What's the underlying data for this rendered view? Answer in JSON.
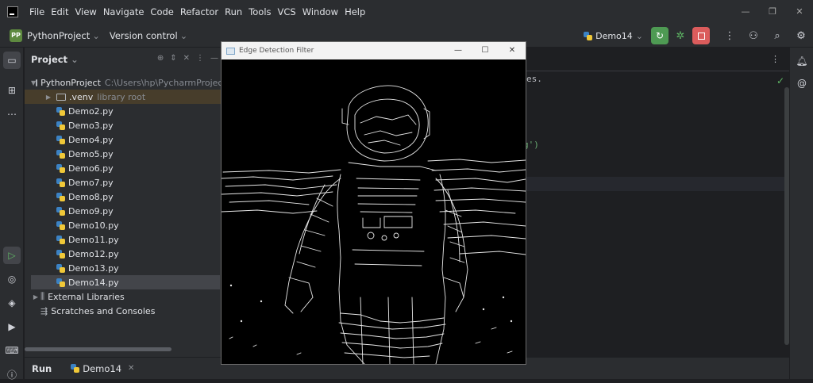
{
  "menu": [
    "File",
    "Edit",
    "View",
    "Navigate",
    "Code",
    "Refactor",
    "Run",
    "Tools",
    "VCS",
    "Window",
    "Help"
  ],
  "toolbar": {
    "project_badge": "PP",
    "project_name": "PythonProject",
    "version_control": "Version control",
    "run_config": "Demo14"
  },
  "project_panel": {
    "title": "Project",
    "root_name": "PythonProject",
    "root_path": "C:\\Users\\hp\\PycharmProjects",
    "venv_name": ".venv",
    "venv_note": "library root",
    "files": [
      "Demo2.py",
      "Demo3.py",
      "Demo4.py",
      "Demo5.py",
      "Demo6.py",
      "Demo7.py",
      "Demo8.py",
      "Demo9.py",
      "Demo10.py",
      "Demo11.py",
      "Demo12.py",
      "Demo13.py",
      "Demo14.py"
    ],
    "selected_file": "Demo14.py",
    "external_libraries": "External Libraries",
    "scratches": "Scratches and Consoles"
  },
  "editor": {
    "snippet_1": "es.",
    "snippet_2": "g')"
  },
  "run_bar": {
    "label": "Run",
    "tab": "Demo14"
  },
  "popup": {
    "title": "Edge Detection Filter"
  }
}
